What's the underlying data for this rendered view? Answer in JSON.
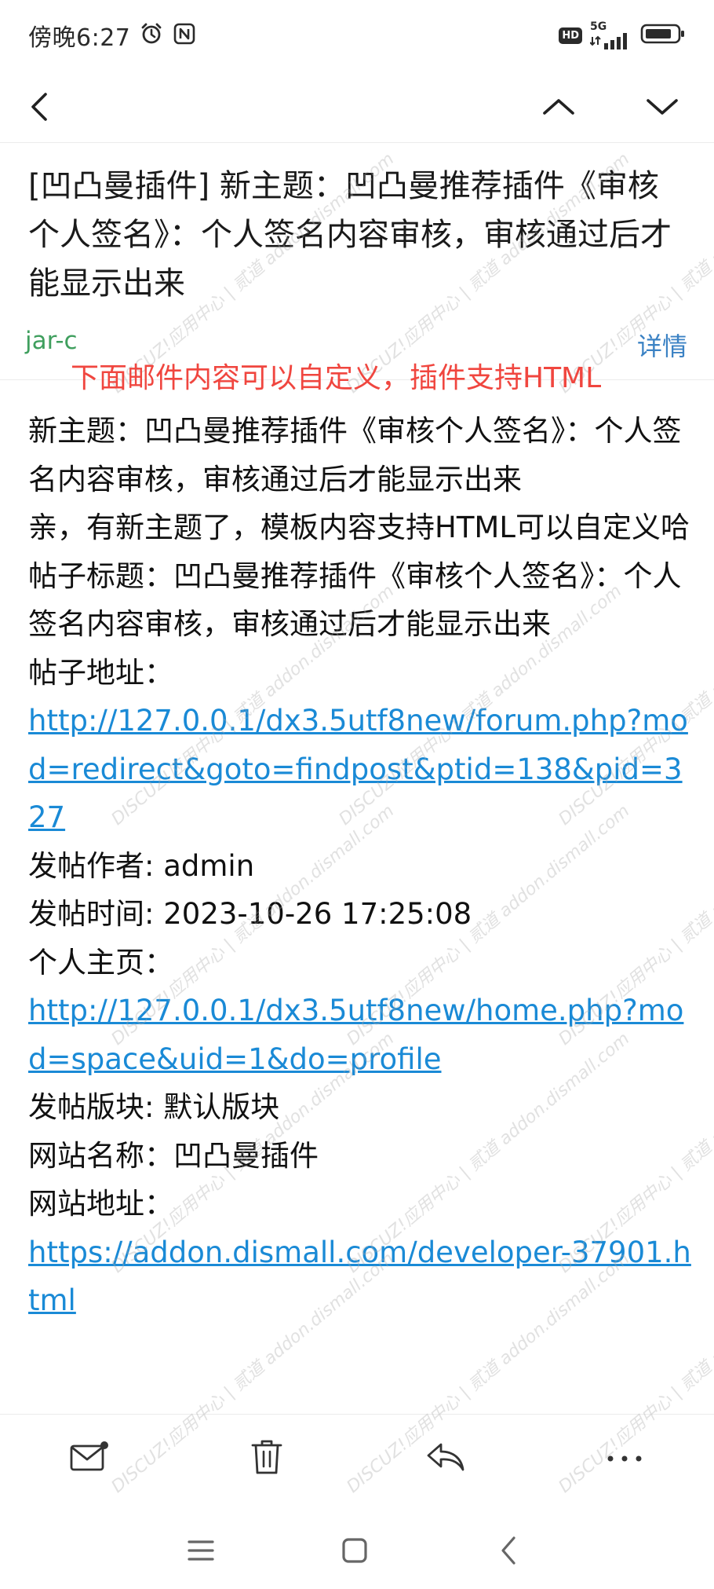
{
  "status_bar": {
    "time": "傍晚6:27",
    "hd_badge": "HD",
    "network": "5G",
    "icons": [
      "alarm-icon",
      "nfc-icon",
      "signal-icon",
      "battery-icon"
    ]
  },
  "nav": {
    "icons": [
      "back-arrow-icon",
      "chevron-up-icon",
      "chevron-down-icon"
    ]
  },
  "email": {
    "subject": "[凹凸曼插件] 新主题：凹凸曼推荐插件《审核个人签名》：个人签名内容审核，审核通过后才能显示出来",
    "sender": "jar-c",
    "details_label": "详情",
    "overlay_note": "下面邮件内容可以自定义，插件支持HTML",
    "body": {
      "line1": "新主题：凹凸曼推荐插件《审核个人签名》：个人签名内容审核，审核通过后才能显示出来",
      "line2_prefix": "亲，有新主题了，模板内容支持HTML可以自定义哈 帖子标题：",
      "line2_title": "凹凸曼推荐插件《审核个人签名》：个人签名内容审核，审核通过后才能显示出来",
      "post_url_label": "帖子地址：",
      "post_url": "http://127.0.0.1/dx3.5utf8new/forum.php?mod=redirect&goto=findpost&ptid=138&pid=327",
      "author_label": "发帖作者: ",
      "author": "admin",
      "time_label": "发帖时间: ",
      "time": "2023-10-26 17:25:08",
      "homepage_label": "个人主页：",
      "homepage_url": "http://127.0.0.1/dx3.5utf8new/home.php?mod=space&uid=1&do=profile",
      "forum_label": "发帖版块: ",
      "forum": "默认版块",
      "site_name_label": "网站名称：",
      "site_name": "凹凸曼插件",
      "site_url_label": "网站地址：",
      "site_url": "https://addon.dismall.com/developer-37901.html"
    }
  },
  "watermark_text": "DISCUZ!应用中心 | 贰道 addon.dismall.com",
  "action_bar": {
    "icons": [
      "mark-unread-icon",
      "trash-icon",
      "reply-icon",
      "more-icon"
    ]
  },
  "system_nav": {
    "icons": [
      "menu-icon",
      "home-square-icon",
      "system-back-icon"
    ]
  }
}
